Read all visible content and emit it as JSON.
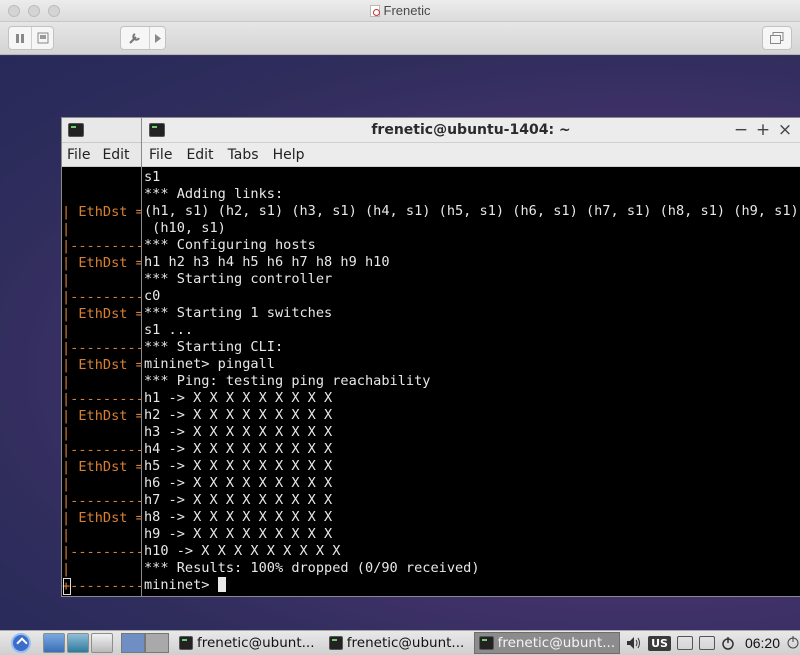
{
  "host_window": {
    "title": "Frenetic"
  },
  "back_terminal": {
    "menu": [
      "File",
      "Edit"
    ],
    "lines": [
      "| EthDst =",
      "|",
      "|---------",
      "| EthDst =",
      "|",
      "|---------",
      "| EthDst =",
      "|",
      "|---------",
      "| EthDst =",
      "|",
      "|---------",
      "| EthDst =",
      "|",
      "|---------",
      "| EthDst =",
      "|",
      "|---------",
      "| EthDst =",
      "|",
      "|---------",
      "|",
      "+---------"
    ]
  },
  "front_terminal": {
    "title": "frenetic@ubuntu-1404: ~",
    "controls": {
      "minimize": "−",
      "maximize": "+",
      "close": "×"
    },
    "menu": [
      "File",
      "Edit",
      "Tabs",
      "Help"
    ],
    "lines": [
      "s1",
      "*** Adding links:",
      "(h1, s1) (h2, s1) (h3, s1) (h4, s1) (h5, s1) (h6, s1) (h7, s1) (h8, s1) (h9, s1)",
      " (h10, s1)",
      "*** Configuring hosts",
      "h1 h2 h3 h4 h5 h6 h7 h8 h9 h10",
      "*** Starting controller",
      "c0",
      "*** Starting 1 switches",
      "s1 ...",
      "*** Starting CLI:",
      "mininet> pingall",
      "*** Ping: testing ping reachability",
      "h1 -> X X X X X X X X X",
      "h2 -> X X X X X X X X X",
      "h3 -> X X X X X X X X X",
      "h4 -> X X X X X X X X X",
      "h5 -> X X X X X X X X X",
      "h6 -> X X X X X X X X X",
      "h7 -> X X X X X X X X X",
      "h8 -> X X X X X X X X X",
      "h9 -> X X X X X X X X X",
      "h10 -> X X X X X X X X X",
      "*** Results: 100% dropped (0/90 received)"
    ],
    "prompt": "mininet> "
  },
  "taskbar": {
    "tasks": [
      {
        "label": "frenetic@ubunt...",
        "active": false
      },
      {
        "label": "frenetic@ubunt...",
        "active": false
      },
      {
        "label": "frenetic@ubunt...",
        "active": true
      }
    ],
    "keyboard_layout": "US",
    "clock": "06:20"
  },
  "colors": {
    "terminal_bg": "#000000",
    "terminal_fg": "#e8e8e8",
    "back_terminal_fg": "#d97f33"
  }
}
